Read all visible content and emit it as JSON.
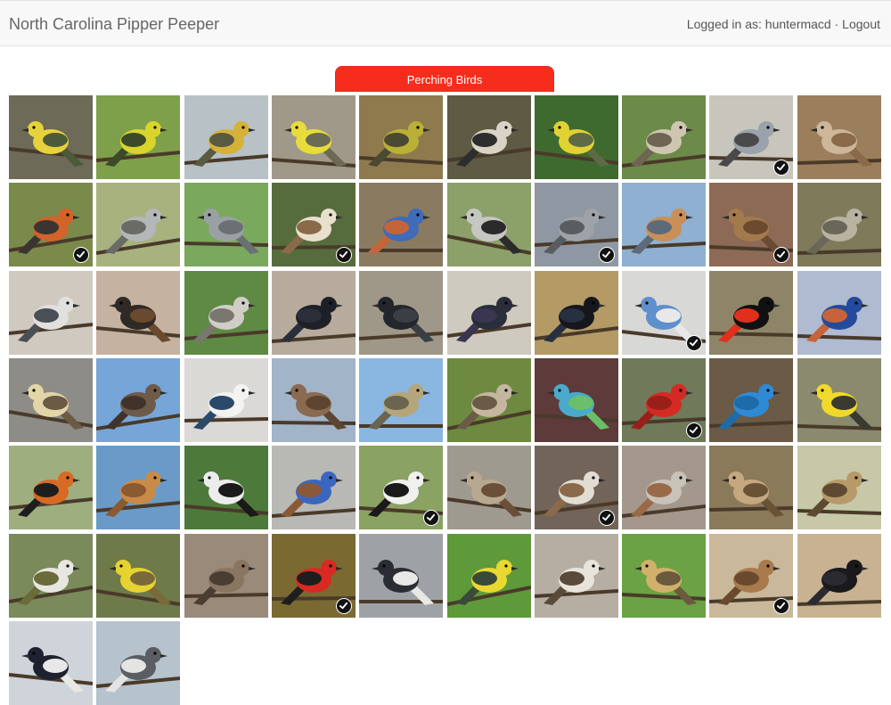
{
  "app": {
    "title": "North Carolina Pipper Peeper",
    "logged_in_prefix": "Logged in as: ",
    "username": "huntermacd",
    "separator": " · ",
    "logout_label": "Logout"
  },
  "category_tab": {
    "label": "Perching Birds"
  },
  "colors": {
    "tab_red": "#f62d1c",
    "check": "#111111"
  },
  "birds": [
    {
      "bg": "#6d6a58",
      "body": "#e6d23a",
      "wing": "#4d5a3a",
      "checked": false
    },
    {
      "bg": "#7fa04a",
      "body": "#d9d52a",
      "wing": "#3c4a2a",
      "checked": false
    },
    {
      "bg": "#b7c1c6",
      "body": "#d4b23a",
      "wing": "#5a5a40",
      "checked": false
    },
    {
      "bg": "#a0998a",
      "body": "#e8dc3a",
      "wing": "#6a6a55",
      "checked": false
    },
    {
      "bg": "#8f7a4e",
      "body": "#b9b035",
      "wing": "#4a4a32",
      "checked": false
    },
    {
      "bg": "#5e5a44",
      "body": "#d8d3c5",
      "wing": "#2d2d2d",
      "checked": false
    },
    {
      "bg": "#3f6a2f",
      "body": "#e0d233",
      "wing": "#5d6a45",
      "checked": false
    },
    {
      "bg": "#6c8a48",
      "body": "#cfc6b2",
      "wing": "#6e6552",
      "checked": false
    },
    {
      "bg": "#c8c6bc",
      "body": "#9aa2ac",
      "wing": "#4a4a4a",
      "checked": true
    },
    {
      "bg": "#9b7e5c",
      "body": "#cdb69a",
      "wing": "#8a6a48",
      "checked": false
    },
    {
      "bg": "#7a8a4a",
      "body": "#d2632a",
      "wing": "#3a3530",
      "checked": true
    },
    {
      "bg": "#a7b27f",
      "body": "#b3b7b8",
      "wing": "#6a6a66",
      "checked": false
    },
    {
      "bg": "#7aa85c",
      "body": "#9aa0a4",
      "wing": "#6b7075",
      "checked": false
    },
    {
      "bg": "#576c3c",
      "body": "#e8e0cc",
      "wing": "#8a6a48",
      "checked": true
    },
    {
      "bg": "#8a7a60",
      "body": "#3f6bb8",
      "wing": "#c4643a",
      "checked": false
    },
    {
      "bg": "#8ca06a",
      "body": "#c6c6c2",
      "wing": "#2b2b2b",
      "checked": false
    },
    {
      "bg": "#8f98a2",
      "body": "#9ea3a8",
      "wing": "#5a5d60",
      "checked": true
    },
    {
      "bg": "#8fb0d0",
      "body": "#c98f56",
      "wing": "#5f6a78",
      "checked": false
    },
    {
      "bg": "#8d6a55",
      "body": "#a37a4c",
      "wing": "#6a4a30",
      "checked": true
    },
    {
      "bg": "#7e7a5a",
      "body": "#b8b2a0",
      "wing": "#6a6658",
      "checked": false
    },
    {
      "bg": "#cfc9c0",
      "body": "#e0e0de",
      "wing": "#4a4f56",
      "checked": false
    },
    {
      "bg": "#c6b2a0",
      "body": "#2f2a26",
      "wing": "#6a4a2e",
      "checked": false
    },
    {
      "bg": "#5f8a44",
      "body": "#d0cdc7",
      "wing": "#7a7670",
      "checked": false
    },
    {
      "bg": "#b6ab9c",
      "body": "#1e2028",
      "wing": "#2a2f3a",
      "checked": false
    },
    {
      "bg": "#9f9788",
      "body": "#23262b",
      "wing": "#3a3f46",
      "checked": false
    },
    {
      "bg": "#cfcabf",
      "body": "#2a2d3a",
      "wing": "#3a3550",
      "checked": false
    },
    {
      "bg": "#b49a64",
      "body": "#15171c",
      "wing": "#263040",
      "checked": false
    },
    {
      "bg": "#d8d8d6",
      "body": "#5f8fcc",
      "wing": "#e8e8e8",
      "checked": true
    },
    {
      "bg": "#8e8468",
      "body": "#111111",
      "wing": "#e02f1c",
      "checked": false
    },
    {
      "bg": "#aebbd0",
      "body": "#244a9c",
      "wing": "#c7633a",
      "checked": false
    },
    {
      "bg": "#8e8c86",
      "body": "#e2d6a8",
      "wing": "#6b5a44",
      "checked": false
    },
    {
      "bg": "#76a6d8",
      "body": "#6f5a4a",
      "wing": "#40342a",
      "checked": false
    },
    {
      "bg": "#dad9d6",
      "body": "#f3f3f2",
      "wing": "#2a4a6a",
      "checked": false
    },
    {
      "bg": "#a2b4c8",
      "body": "#8a6a50",
      "wing": "#5d4532",
      "checked": false
    },
    {
      "bg": "#8ab6e2",
      "body": "#b4a67a",
      "wing": "#6a6450",
      "checked": false
    },
    {
      "bg": "#6d8a40",
      "body": "#c4b6a0",
      "wing": "#6a5a46",
      "checked": false
    },
    {
      "bg": "#5f3a3a",
      "body": "#4aaacc",
      "wing": "#6bbf6a",
      "checked": false
    },
    {
      "bg": "#6e7a5a",
      "body": "#d42a22",
      "wing": "#9a1f1a",
      "checked": true
    },
    {
      "bg": "#6a5a46",
      "body": "#2f8ad6",
      "wing": "#1f6aa8",
      "checked": false
    },
    {
      "bg": "#8a8a6e",
      "body": "#f0d92a",
      "wing": "#3a3a30",
      "checked": false
    },
    {
      "bg": "#9fae7e",
      "body": "#d76a24",
      "wing": "#1e1e1e",
      "checked": false
    },
    {
      "bg": "#6a9ac8",
      "body": "#c98a48",
      "wing": "#8a5a30",
      "checked": false
    },
    {
      "bg": "#4d7a3a",
      "body": "#ececec",
      "wing": "#1a1a1a",
      "checked": false
    },
    {
      "bg": "#b8b8b4",
      "body": "#3a66c0",
      "wing": "#8a5a38",
      "checked": false
    },
    {
      "bg": "#8aa262",
      "body": "#f0f0ee",
      "wing": "#1a1a1a",
      "checked": true
    },
    {
      "bg": "#9f9a90",
      "body": "#b8a890",
      "wing": "#6a5038",
      "checked": false
    },
    {
      "bg": "#73645a",
      "body": "#e2ddd2",
      "wing": "#8a6a4a",
      "checked": true
    },
    {
      "bg": "#a4988c",
      "body": "#c8c2b8",
      "wing": "#9a6a48",
      "checked": false
    },
    {
      "bg": "#8a7a5a",
      "body": "#c6a880",
      "wing": "#6a5236",
      "checked": false
    },
    {
      "bg": "#c6c8a8",
      "body": "#b89a6a",
      "wing": "#5e4a32",
      "checked": false
    },
    {
      "bg": "#7a8a5a",
      "body": "#e8e6e0",
      "wing": "#6a6a3a",
      "checked": false
    },
    {
      "bg": "#6f7a4a",
      "body": "#e6d230",
      "wing": "#7a6a3a",
      "checked": false
    },
    {
      "bg": "#9a8a7a",
      "body": "#8a7560",
      "wing": "#4a3e32",
      "checked": false
    },
    {
      "bg": "#7a6a32",
      "body": "#d82a22",
      "wing": "#1e1e1e",
      "checked": true
    },
    {
      "bg": "#9ea2a6",
      "body": "#2a2d33",
      "wing": "#e8e8e6",
      "checked": false
    },
    {
      "bg": "#5e9a3a",
      "body": "#e8d830",
      "wing": "#3a4a3a",
      "checked": false
    },
    {
      "bg": "#b6aea2",
      "body": "#e8e4dc",
      "wing": "#5a4a3a",
      "checked": false
    },
    {
      "bg": "#6aa244",
      "body": "#d0b06a",
      "wing": "#6a5a3e",
      "checked": false
    },
    {
      "bg": "#c9b89a",
      "body": "#a87a4c",
      "wing": "#6a4a2e",
      "checked": true
    },
    {
      "bg": "#c8b292",
      "body": "#1a1a1c",
      "wing": "#2a2a30",
      "checked": false
    },
    {
      "bg": "#cfd4da",
      "body": "#1e2230",
      "wing": "#e8e8e8",
      "checked": false
    },
    {
      "bg": "#b6c2cc",
      "body": "#5a5e62",
      "wing": "#e4e4e2",
      "checked": false
    }
  ]
}
